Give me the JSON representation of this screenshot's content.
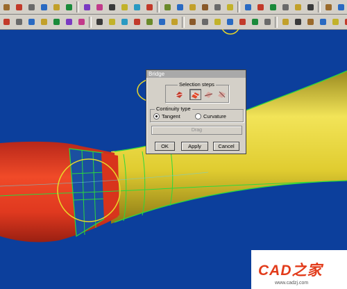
{
  "toolbar_top": {
    "icons": [
      "#9a6a2c",
      "#c23a2a",
      "#6a6a6a",
      "#2a6ac2",
      "#c2a02a",
      "#1a8a3a",
      "#7a3ac2",
      "#c23a8a",
      "#3a3a3a",
      "#c2b22a",
      "#2a9ac2",
      "#c23a2a",
      "#6a8a2a",
      "#2a6ac2",
      "#c2a02a",
      "#8a5a2a",
      "#6a6a6a",
      "#c2b22a",
      "#2a6ac2",
      "#c23a2a",
      "#1a8a3a",
      "#6a6a6a",
      "#c2a02a",
      "#3a3a3a",
      "#9a6a2c",
      "#2a6ac2",
      "#c2b22a",
      "#c23a2a",
      "#6a8a2a",
      "#2a9ac2"
    ]
  },
  "toolbar_second": {
    "icons": [
      "#c23a2a",
      "#6a6a6a",
      "#2a6ac2",
      "#c2a02a",
      "#1a8a3a",
      "#7a3ac2",
      "#c23a8a",
      "#3a3a3a",
      "#c2b22a",
      "#2a9ac2",
      "#c23a2a",
      "#6a8a2a",
      "#2a6ac2",
      "#c2a02a",
      "#8a5a2a",
      "#6a6a6a",
      "#c2b22a",
      "#2a6ac2",
      "#c23a2a",
      "#1a8a3a",
      "#6a6a6a",
      "#c2a02a",
      "#3a3a3a",
      "#9a6a2c",
      "#2a6ac2",
      "#c2b22a",
      "#c23a2a",
      "#6a8a2a"
    ]
  },
  "dialog": {
    "title": "Bridge",
    "selection_steps_label": "Selection steps",
    "continuity_label": "Continuity type",
    "tangent_label": "Tangent",
    "curvature_label": "Curvature",
    "selected_continuity": "Tangent",
    "drag_label": "Drag",
    "ok_label": "OK",
    "apply_label": "Apply",
    "cancel_label": "Cancel"
  },
  "watermark": {
    "logo": "CAD之家",
    "url": "www.cadzj.com"
  },
  "colors": {
    "background": "#0c3f9c",
    "red_surface": "#e0391f",
    "yellow_surface": "#e6d43a",
    "wire": "#2cd83c",
    "highlight_circle": "#e8d72a"
  }
}
